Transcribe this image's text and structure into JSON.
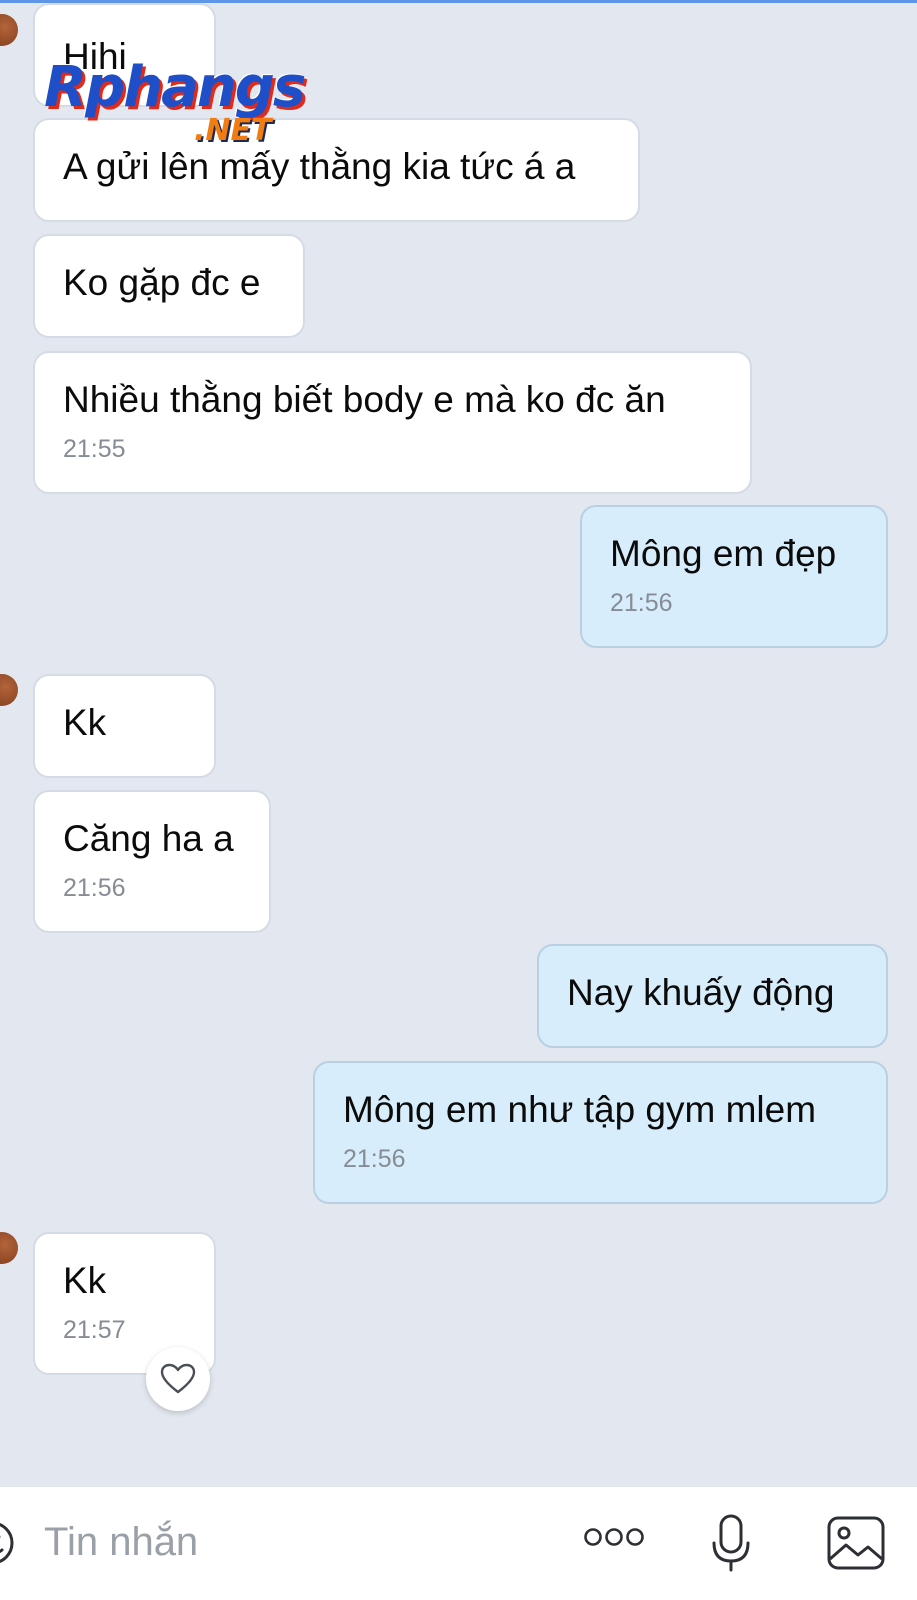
{
  "messages": [
    {
      "direction": "in",
      "text": "Hihi",
      "time": ""
    },
    {
      "direction": "in",
      "text": "A gửi lên mấy thằng kia tức á a",
      "time": ""
    },
    {
      "direction": "in",
      "text": "Ko gặp đc e",
      "time": ""
    },
    {
      "direction": "in",
      "text": "Nhiều thằng biết body e mà ko đc ăn",
      "time": "21:55"
    },
    {
      "direction": "out",
      "text": "Mông em đẹp",
      "time": "21:56"
    },
    {
      "direction": "in",
      "text": "Kk",
      "time": ""
    },
    {
      "direction": "in",
      "text": "Căng ha a",
      "time": "21:56"
    },
    {
      "direction": "out",
      "text": "Nay khuấy động",
      "time": ""
    },
    {
      "direction": "out",
      "text": "Mông em như tập gym mlem",
      "time": "21:56"
    },
    {
      "direction": "in",
      "text": "Kk",
      "time": "21:57"
    }
  ],
  "watermark": {
    "main": "Rphangs",
    "sub": ".NET"
  },
  "composer": {
    "placeholder": "Tin nhắn",
    "icons": [
      "emoji-icon",
      "more-icon",
      "mic-icon",
      "image-icon"
    ]
  },
  "colors": {
    "background": "#e3e8f0",
    "incoming_bubble": "#ffffff",
    "outgoing_bubble": "#d8edfb",
    "top_accent": "#5e95e6",
    "timestamp": "#868c94"
  }
}
